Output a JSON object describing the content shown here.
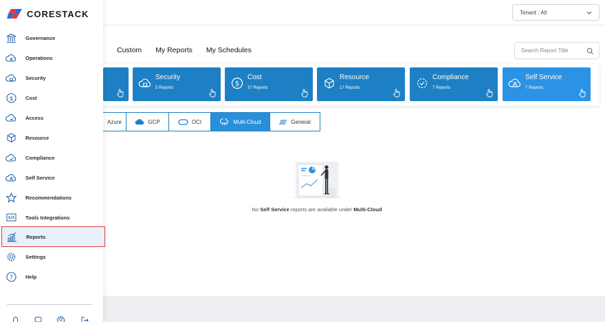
{
  "brand": {
    "name": "CORESTACK"
  },
  "sidebar": {
    "items": [
      {
        "label": "Governance",
        "icon": "bank-icon"
      },
      {
        "label": "Operations",
        "icon": "cloud-gear-icon"
      },
      {
        "label": "Security",
        "icon": "cloud-lock-icon"
      },
      {
        "label": "Cost",
        "icon": "dollar-circle-icon"
      },
      {
        "label": "Access",
        "icon": "cloud-user-icon"
      },
      {
        "label": "Resource",
        "icon": "cube-icon"
      },
      {
        "label": "Compliance",
        "icon": "cloud-check-icon"
      },
      {
        "label": "Self Service",
        "icon": "cloud-person-icon"
      },
      {
        "label": "Recommendations",
        "icon": "star-icon"
      },
      {
        "label": "Tools Integrations",
        "icon": "code-icon"
      },
      {
        "label": "Reports",
        "icon": "bar-chart-icon"
      },
      {
        "label": "Settings",
        "icon": "gear-icon"
      },
      {
        "label": "Help",
        "icon": "question-icon"
      }
    ],
    "active": "Reports"
  },
  "tenant": {
    "label": "Tenant : All"
  },
  "tabs": [
    "Custom",
    "My Reports",
    "My Schedules"
  ],
  "search": {
    "placeholder": "Search Report Title"
  },
  "cards": [
    {
      "title": "",
      "sub": ""
    },
    {
      "title": "Security",
      "sub": "5 Reports"
    },
    {
      "title": "Cost",
      "sub": "37 Reports"
    },
    {
      "title": "Resource",
      "sub": "17 Reports"
    },
    {
      "title": "Compliance",
      "sub": "7 Reports"
    },
    {
      "title": "Self Service",
      "sub": "7 Reports"
    }
  ],
  "filters": [
    "Azure",
    "GCP",
    "OCI",
    "Multi-Cloud",
    "General"
  ],
  "selected_filter": "Multi-Cloud",
  "empty": {
    "pre": "No",
    "b1": "Self Service",
    "mid": "reports are available under",
    "b2": "Multi-Cloud"
  },
  "colors": {
    "accent": "#1e80c4",
    "selected": "#2a93e6",
    "highlight_border": "#e03b3b"
  }
}
